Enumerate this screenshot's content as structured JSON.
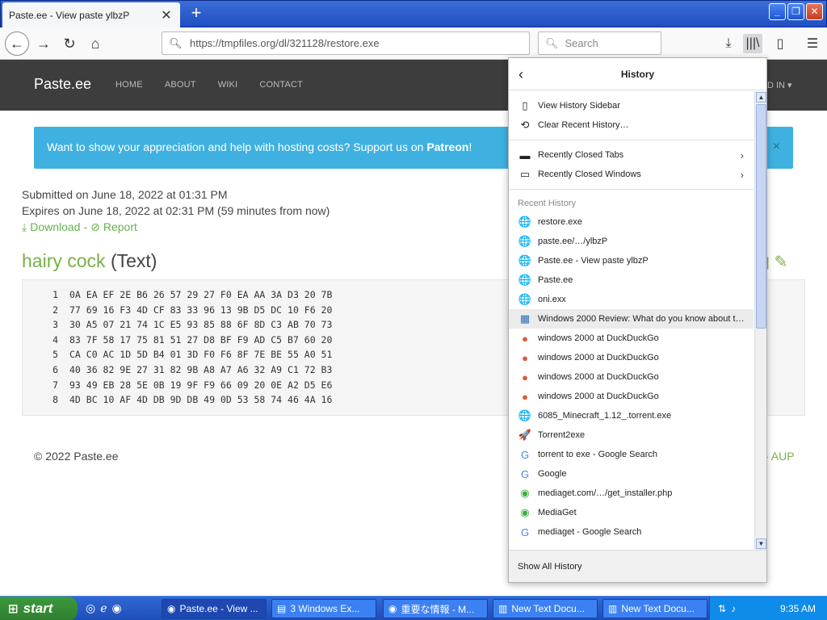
{
  "tab": {
    "title": "Paste.ee - View paste ylbzP",
    "close": "✕"
  },
  "newtab": "+",
  "nav": {
    "url": "https://tmpfiles.org/dl/321128/restore.exe",
    "search_placeholder": "Search"
  },
  "site": {
    "brand": "Paste.ee",
    "links": [
      "HOME",
      "ABOUT",
      "WIKI",
      "CONTACT"
    ],
    "login": "D IN ▾",
    "alert_text": "Want to show your appreciation and help with hosting costs? Support us on ",
    "alert_bold": "Patreon",
    "alert_end": "!",
    "alert_close": "×",
    "submitted": "Submitted on June 18, 2022 at 01:31 PM",
    "expires": "Expires on June 18, 2022 at 02:31 PM (59 minutes from now)",
    "download": "Download",
    "report": "Report",
    "paste_title": "hairy cock",
    "paste_type": "(Text)",
    "code_lines": [
      {
        "n": "1",
        "t": "0A EA EF 2E B6 26 57 29 27 F0 EA AA 3A D3 20 7B"
      },
      {
        "n": "2",
        "t": "77 69 16 F3 4D CF 83 33 96 13 9B D5 DC 10 F6 20"
      },
      {
        "n": "3",
        "t": "30 A5 07 21 74 1C E5 93 85 88 6F 8D C3 AB 70 73"
      },
      {
        "n": "4",
        "t": "83 7F 58 17 75 81 51 27 D8 BF F9 AD C5 B7 60 20"
      },
      {
        "n": "5",
        "t": "CA C0 AC 1D 5D B4 01 3D F0 F6 8F 7E BE 55 A0 51"
      },
      {
        "n": "6",
        "t": "40 36 82 9E 27 31 82 9B A8 A7 A6 32 A9 C1 72 B3"
      },
      {
        "n": "7",
        "t": "93 49 EB 28 5E 0B 19 9F F9 66 09 20 0E A2 D5 E6"
      },
      {
        "n": "8",
        "t": "4D BC 10 AF 4D DB 9D DB 49 0D 53 58 74 46 4A 16"
      }
    ],
    "footer": "© 2022 Paste.ee",
    "aup": "- AUP"
  },
  "history": {
    "title": "History",
    "top_items": [
      {
        "icon": "sidebar-icon",
        "glyph": "▯",
        "label": "View History Sidebar"
      },
      {
        "icon": "clock-icon",
        "glyph": "⟲",
        "label": "Clear Recent History…"
      }
    ],
    "closed_items": [
      {
        "icon": "tab-icon",
        "glyph": "▬",
        "label": "Recently Closed Tabs"
      },
      {
        "icon": "window-icon",
        "glyph": "▭",
        "label": "Recently Closed Windows"
      }
    ],
    "recent_header": "Recent History",
    "recent": [
      {
        "icon": "globe-icon",
        "glyph": "🌐",
        "label": "restore.exe"
      },
      {
        "icon": "globe-icon",
        "glyph": "🌐",
        "label": "paste.ee/…/ylbzP"
      },
      {
        "icon": "globe-icon",
        "glyph": "🌐",
        "label": "Paste.ee - View paste ylbzP"
      },
      {
        "icon": "globe-icon",
        "glyph": "🌐",
        "label": "Paste.ee"
      },
      {
        "icon": "globe-icon",
        "glyph": "🌐",
        "label": "oni.exx"
      },
      {
        "icon": "site-icon",
        "glyph": "▦",
        "label": "Windows 2000 Review: What do you know about t…"
      },
      {
        "icon": "duckduckgo-icon",
        "glyph": "●",
        "label": "windows 2000 at DuckDuckGo"
      },
      {
        "icon": "duckduckgo-icon",
        "glyph": "●",
        "label": "windows 2000 at DuckDuckGo"
      },
      {
        "icon": "duckduckgo-icon",
        "glyph": "●",
        "label": "windows 2000 at DuckDuckGo"
      },
      {
        "icon": "duckduckgo-icon",
        "glyph": "●",
        "label": "windows 2000 at DuckDuckGo"
      },
      {
        "icon": "globe-icon",
        "glyph": "🌐",
        "label": "6085_Minecraft_1.12_.torrent.exe"
      },
      {
        "icon": "rocket-icon",
        "glyph": "🚀",
        "label": "Torrent2exe"
      },
      {
        "icon": "google-icon",
        "glyph": "G",
        "label": "torrent to exe - Google Search"
      },
      {
        "icon": "google-icon",
        "glyph": "G",
        "label": "Google"
      },
      {
        "icon": "mediaget-icon",
        "glyph": "◉",
        "label": "mediaget.com/…/get_installer.php"
      },
      {
        "icon": "mediaget-icon",
        "glyph": "◉",
        "label": "MediaGet"
      },
      {
        "icon": "google-icon",
        "glyph": "G",
        "label": "mediaget - Google Search"
      }
    ],
    "footer": "Show All History"
  },
  "taskbar": {
    "start": "start",
    "buttons": [
      {
        "label": "Paste.ee - View ...",
        "icon": "firefox-icon"
      },
      {
        "label": "3 Windows Ex...",
        "icon": "folder-icon"
      },
      {
        "label": "重要な情報 - M...",
        "icon": "firefox-icon"
      },
      {
        "label": "New Text Docu...",
        "icon": "notepad-icon"
      },
      {
        "label": "New Text Docu...",
        "icon": "notepad-icon"
      }
    ],
    "clock": "9:35 AM"
  },
  "colors": {
    "accent_green": "#78b04a",
    "alert_blue": "#3fb1e1",
    "nav_dark": "#3d3d3d"
  }
}
